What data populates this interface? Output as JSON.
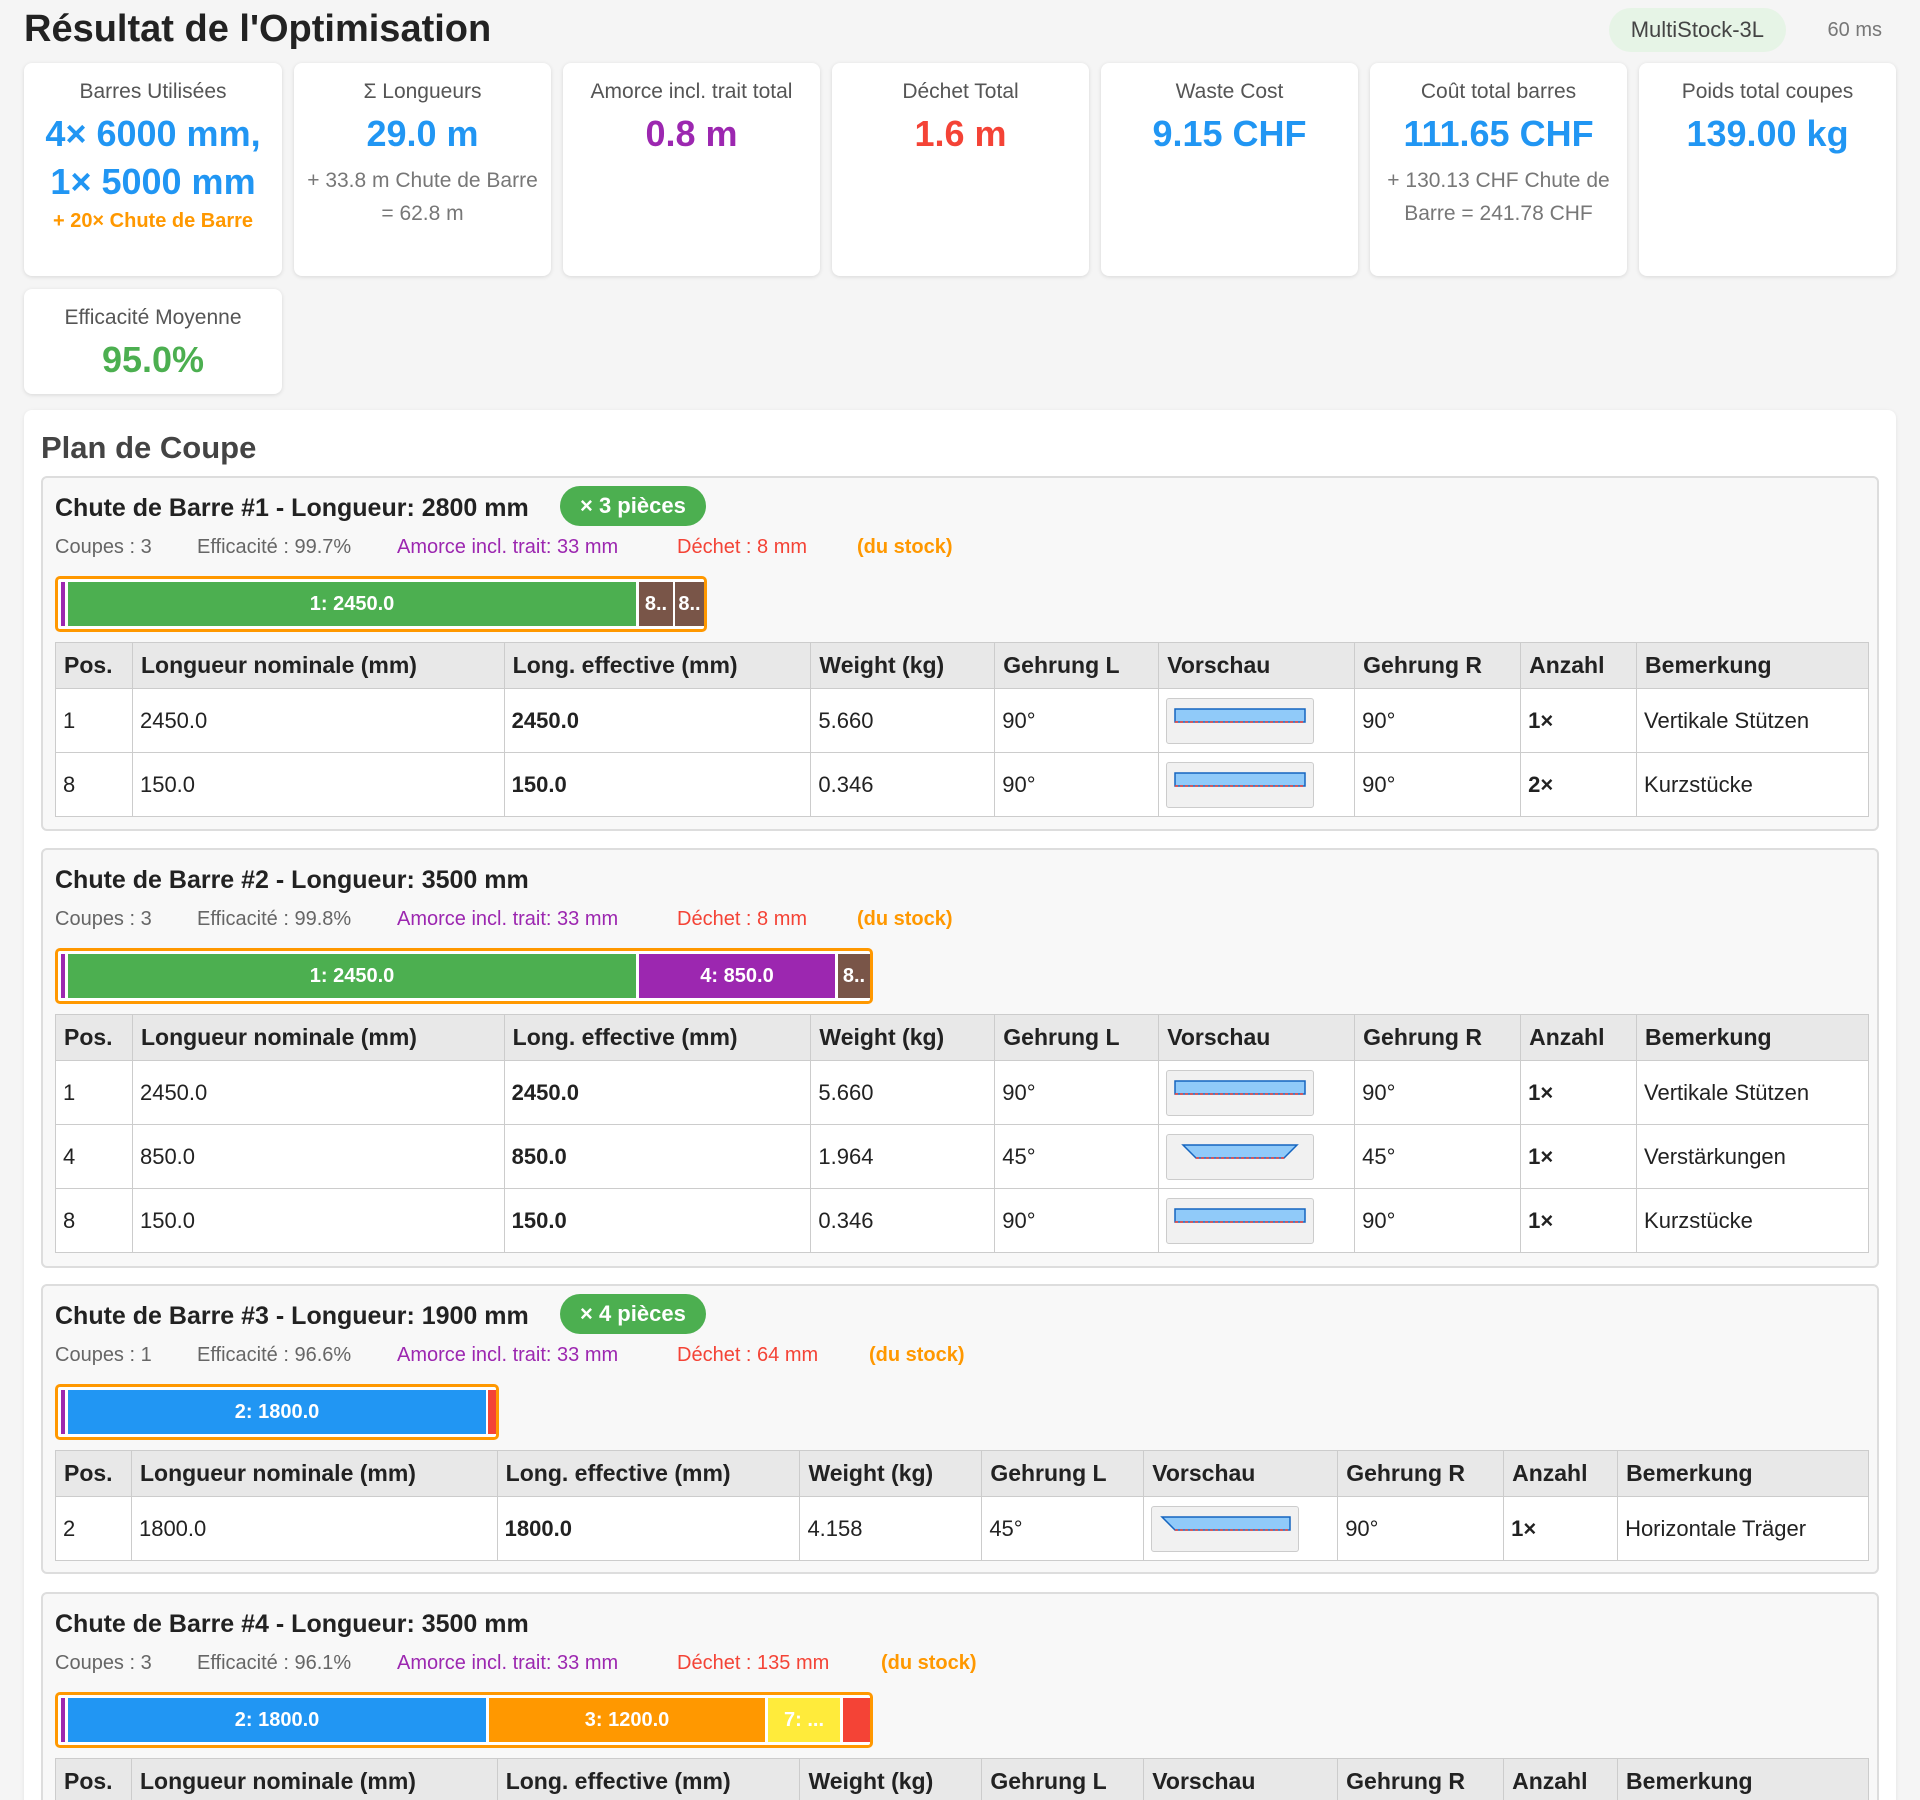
{
  "header": {
    "title": "Résultat de l'Optimisation",
    "algorithm": "MultiStock-3L",
    "time": "60 ms"
  },
  "stats": {
    "bars": {
      "label": "Barres Utilisées",
      "value_line1": "4× 6000 mm,",
      "value_line2": "1× 5000 mm",
      "sub": "+ 20× Chute de Barre"
    },
    "lengths": {
      "label": "Σ Longueurs",
      "value": "29.0 m",
      "sub": "+ 33.8 m Chute de Barre = 62.8 m"
    },
    "kerf": {
      "label": "Amorce incl. trait total",
      "value": "0.8 m"
    },
    "waste": {
      "label": "Déchet Total",
      "value": "1.6 m"
    },
    "waste_cost": {
      "label": "Waste Cost",
      "value": "9.15 CHF"
    },
    "bar_cost": {
      "label": "Coût total barres",
      "value": "111.65 CHF",
      "sub": "+ 130.13 CHF Chute de Barre = 241.78 CHF"
    },
    "weight": {
      "label": "Poids total coupes",
      "value": "139.00 kg"
    },
    "efficiency": {
      "label": "Efficacité Moyenne",
      "value": "95.0%"
    }
  },
  "plan": {
    "title": "Plan de Coupe",
    "columns": [
      "Pos.",
      "Longueur nominale (mm)",
      "Long. effective (mm)",
      "Weight (kg)",
      "Gehrung L",
      "Vorschau",
      "Gehrung R",
      "Anzahl",
      "Bemerkung"
    ],
    "bars": [
      {
        "title": "Chute de Barre #1 - Longueur: 2800 mm",
        "pieces": "× 3 pièces",
        "cuts": "Coupes : 3",
        "efficiency": "Efficacité : 99.7%",
        "kerf": "Amorce incl. trait: 33 mm",
        "waste": "Déchet : 8 mm",
        "stock": "(du stock)",
        "segments": [
          {
            "label": "1: 2450.0",
            "color": "#4caf50"
          },
          {
            "label": "8..",
            "color": "#795548"
          },
          {
            "label": "8..",
            "color": "#795548"
          }
        ],
        "rows": [
          {
            "pos": "1",
            "nominal": "2450.0",
            "effective": "2450.0",
            "weight": "5.660",
            "miter_l": "90°",
            "miter_r": "90°",
            "qty": "1×",
            "note": "Vertikale Stützen"
          },
          {
            "pos": "8",
            "nominal": "150.0",
            "effective": "150.0",
            "weight": "0.346",
            "miter_l": "90°",
            "miter_r": "90°",
            "qty": "2×",
            "note": "Kurzstücke"
          }
        ]
      },
      {
        "title": "Chute de Barre #2 - Longueur: 3500 mm",
        "pieces": "",
        "cuts": "Coupes : 3",
        "efficiency": "Efficacité : 99.8%",
        "kerf": "Amorce incl. trait: 33 mm",
        "waste": "Déchet : 8 mm",
        "stock": "(du stock)",
        "segments": [
          {
            "label": "1: 2450.0",
            "color": "#4caf50"
          },
          {
            "label": "4: 850.0",
            "color": "#9c27b0"
          },
          {
            "label": "8..",
            "color": "#795548"
          }
        ],
        "rows": [
          {
            "pos": "1",
            "nominal": "2450.0",
            "effective": "2450.0",
            "weight": "5.660",
            "miter_l": "90°",
            "miter_r": "90°",
            "qty": "1×",
            "note": "Vertikale Stützen"
          },
          {
            "pos": "4",
            "nominal": "850.0",
            "effective": "850.0",
            "weight": "1.964",
            "miter_l": "45°",
            "miter_r": "45°",
            "qty": "1×",
            "note": "Verstärkungen"
          },
          {
            "pos": "8",
            "nominal": "150.0",
            "effective": "150.0",
            "weight": "0.346",
            "miter_l": "90°",
            "miter_r": "90°",
            "qty": "1×",
            "note": "Kurzstücke"
          }
        ]
      },
      {
        "title": "Chute de Barre #3 - Longueur: 1900 mm",
        "pieces": "× 4 pièces",
        "cuts": "Coupes : 1",
        "efficiency": "Efficacité : 96.6%",
        "kerf": "Amorce incl. trait: 33 mm",
        "waste": "Déchet : 64 mm",
        "stock": "(du stock)",
        "segments": [
          {
            "label": "2: 1800.0",
            "color": "#2196f3"
          }
        ],
        "rows": [
          {
            "pos": "2",
            "nominal": "1800.0",
            "effective": "1800.0",
            "weight": "4.158",
            "miter_l": "45°",
            "miter_r": "90°",
            "qty": "1×",
            "note": "Horizontale Träger"
          }
        ]
      },
      {
        "title": "Chute de Barre #4 - Longueur: 3500 mm",
        "pieces": "",
        "cuts": "Coupes : 3",
        "efficiency": "Efficacité : 96.1%",
        "kerf": "Amorce incl. trait: 33 mm",
        "waste": "Déchet : 135 mm",
        "stock": "(du stock)",
        "segments": [
          {
            "label": "2: 1800.0",
            "color": "#2196f3"
          },
          {
            "label": "3: 1200.0",
            "color": "#ff9800"
          },
          {
            "label": "7: ...",
            "color": "#ffeb3b"
          }
        ],
        "rows": []
      }
    ]
  }
}
